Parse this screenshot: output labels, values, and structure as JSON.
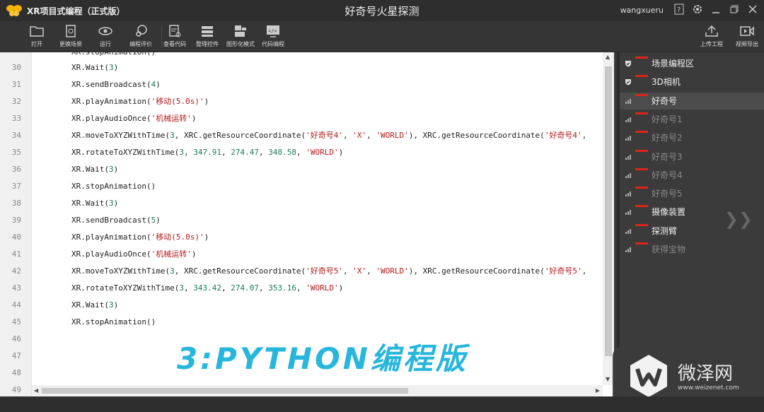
{
  "titlebar": {
    "app_title": "XR项目式编程（正式版）",
    "doc_title": "好奇号火星探测",
    "user": "wangxueru"
  },
  "toolbar": {
    "left_tools": [
      {
        "label": "打开",
        "icon": "folder-icon"
      },
      {
        "label": "更换场景",
        "icon": "swap-scene-icon"
      },
      {
        "label": "运行",
        "icon": "eye-icon"
      },
      {
        "label": "编程评价",
        "icon": "evaluate-icon"
      },
      {
        "label": "查看代码",
        "icon": "view-code-icon"
      },
      {
        "label": "整理控件",
        "icon": "arrange-icon"
      },
      {
        "label": "图形化模式",
        "icon": "graphic-mode-icon"
      },
      {
        "label": "代码编程",
        "icon": "code-mode-icon"
      }
    ],
    "right_tools": [
      {
        "label": "上传工程",
        "icon": "upload-icon"
      },
      {
        "label": "视频导出",
        "icon": "video-export-icon"
      }
    ]
  },
  "editor": {
    "lines": [
      {
        "n": "30",
        "code": "XR.Wait(3)"
      },
      {
        "n": "31",
        "code": "XR.sendBroadcast(4)"
      },
      {
        "n": "32",
        "code": "XR.playAnimation('移动(5.0s)')"
      },
      {
        "n": "33",
        "code": "XR.playAudioOnce('机械运转')"
      },
      {
        "n": "34",
        "code": "XR.moveToXYZWithTime(3, XRC.getResourceCoordinate('好奇号4', 'X', 'WORLD'), XRC.getResourceCoordinate('好奇号4',"
      },
      {
        "n": "35",
        "code": "XR.rotateToXYZWithTime(3, 347.91, 274.47, 348.58, 'WORLD')"
      },
      {
        "n": "36",
        "code": "XR.Wait(3)"
      },
      {
        "n": "37",
        "code": "XR.stopAnimation()"
      },
      {
        "n": "38",
        "code": "XR.Wait(3)"
      },
      {
        "n": "39",
        "code": "XR.sendBroadcast(5)"
      },
      {
        "n": "40",
        "code": "XR.playAnimation('移动(5.0s)')"
      },
      {
        "n": "41",
        "code": "XR.playAudioOnce('机械运转')"
      },
      {
        "n": "42",
        "code": "XR.moveToXYZWithTime(3, XRC.getResourceCoordinate('好奇号5', 'X', 'WORLD'), XRC.getResourceCoordinate('好奇号5',"
      },
      {
        "n": "43",
        "code": "XR.rotateToXYZWithTime(3, 343.42, 274.07, 353.16, 'WORLD')"
      },
      {
        "n": "44",
        "code": "XR.Wait(3)"
      },
      {
        "n": "45",
        "code": "XR.stopAnimation()"
      },
      {
        "n": "46",
        "code": ""
      },
      {
        "n": "47",
        "code": ""
      },
      {
        "n": "48",
        "code": ""
      },
      {
        "n": "49",
        "code": ""
      }
    ],
    "partial_top_line": "XR.stopAnimation()",
    "banner": "3:PYTHON编程版"
  },
  "scene_tree": [
    {
      "label": "场景编程区",
      "icon": "shield-icon",
      "dim": false,
      "selected": false
    },
    {
      "label": "3D相机",
      "icon": "shield-icon",
      "dim": false,
      "selected": false
    },
    {
      "label": "好奇号",
      "icon": "bars-icon",
      "dim": false,
      "selected": true
    },
    {
      "label": "好奇号1",
      "icon": "bars-icon",
      "dim": true,
      "selected": false
    },
    {
      "label": "好奇号2",
      "icon": "bars-icon",
      "dim": true,
      "selected": false
    },
    {
      "label": "好奇号3",
      "icon": "bars-icon",
      "dim": true,
      "selected": false
    },
    {
      "label": "好奇号4",
      "icon": "bars-icon",
      "dim": true,
      "selected": false
    },
    {
      "label": "好奇号5",
      "icon": "bars-icon",
      "dim": true,
      "selected": false
    },
    {
      "label": "摄像装置",
      "icon": "bars-icon",
      "dim": false,
      "selected": false
    },
    {
      "label": "探测臂",
      "icon": "bars-icon",
      "dim": false,
      "selected": false
    },
    {
      "label": "获得宝物",
      "icon": "bars-icon",
      "dim": true,
      "selected": false
    }
  ],
  "watermark": {
    "name": "微泽网",
    "url": "www.weizenet.com"
  },
  "colors": {
    "accent": "#27b6dc",
    "string": "#b51a1a",
    "number": "#1a7a5a",
    "tag": "#d9261c"
  }
}
